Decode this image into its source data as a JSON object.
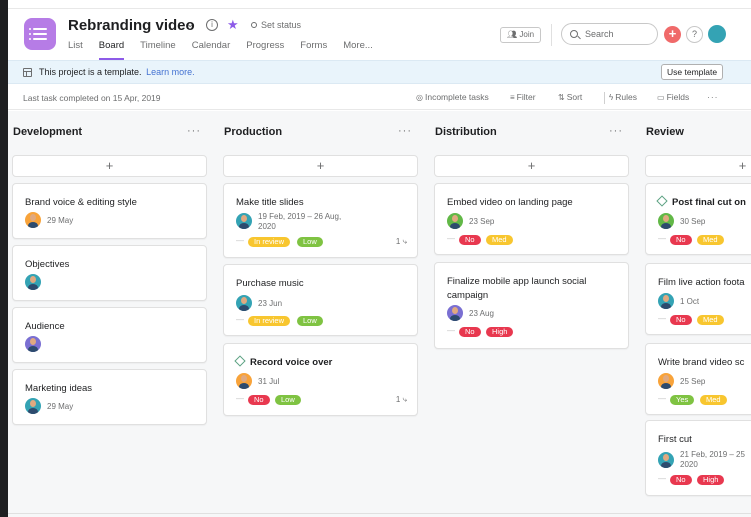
{
  "project": {
    "title": "Rebranding video",
    "set_status": "Set status"
  },
  "tabs": [
    "List",
    "Board",
    "Timeline",
    "Calendar",
    "Progress",
    "Forms",
    "More..."
  ],
  "active_tab": "Board",
  "header_actions": {
    "join": "Join",
    "search_placeholder": "Search",
    "help": "?"
  },
  "banner": {
    "text": "This project is a template.",
    "link": "Learn more.",
    "button": "Use template"
  },
  "toolbar": {
    "last_task": "Last task completed on 15 Apr, 2019",
    "incomplete": "Incomplete tasks",
    "filter": "Filter",
    "sort": "Sort",
    "rules": "Rules",
    "fields": "Fields"
  },
  "columns": [
    {
      "title": "Development",
      "cards": [
        {
          "title": "Brand voice & editing style",
          "date": "29 May",
          "avatar": "orange"
        },
        {
          "title": "Objectives",
          "date": "",
          "avatar": "teal"
        },
        {
          "title": "Audience",
          "date": "",
          "avatar": "purple"
        },
        {
          "title": "Marketing ideas",
          "date": "29 May",
          "avatar": "teal"
        }
      ]
    },
    {
      "title": "Production",
      "cards": [
        {
          "title": "Make title slides",
          "date": "19 Feb, 2019 – 26 Aug, 2020",
          "tags": [
            "In review",
            "Low"
          ],
          "subtasks": "1"
        },
        {
          "title": "Purchase music",
          "date": "23 Jun",
          "tags": [
            "In review",
            "Low"
          ]
        },
        {
          "title": "Record voice over",
          "date": "31 Jul",
          "tags": [
            "No",
            "Low"
          ],
          "subtasks": "1",
          "milestone": true
        }
      ]
    },
    {
      "title": "Distribution",
      "cards": [
        {
          "title": "Embed video on landing page",
          "date": "23 Sep",
          "tags": [
            "No",
            "Med"
          ]
        },
        {
          "title": "Finalize mobile app launch social campaign",
          "date": "23 Aug",
          "tags": [
            "No",
            "High"
          ]
        }
      ]
    },
    {
      "title": "Review",
      "cards": [
        {
          "title": "Post final cut on",
          "date": "30 Sep",
          "tags": [
            "No",
            "Med"
          ],
          "milestone": true
        },
        {
          "title": "Film live action foota",
          "date": "1 Oct",
          "tags": [
            "No",
            "Med"
          ]
        },
        {
          "title": "Write brand video sc",
          "date": "25 Sep",
          "tags": [
            "Yes",
            "Med"
          ]
        },
        {
          "title": "First cut",
          "date": "21 Feb, 2019 – 25 2020",
          "tags": [
            "No",
            "High"
          ]
        }
      ]
    }
  ],
  "colors": {
    "accent": "#8d5be8",
    "project_icon": "#b67ce6",
    "tag_red": "#e8384f",
    "tag_yellow": "#f8c62f",
    "tag_green": "#7fc342",
    "link": "#4573d2"
  }
}
